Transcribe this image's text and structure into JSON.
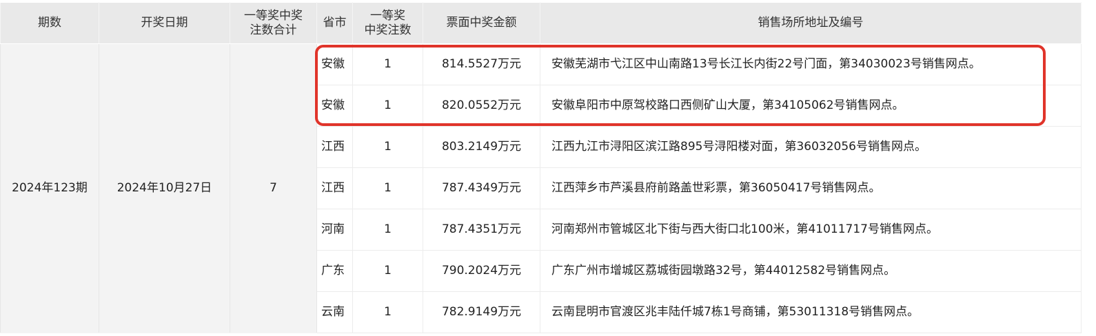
{
  "columns": {
    "period": "期数",
    "date": "开奖日期",
    "total_line1": "一等奖中奖",
    "total_line2": "注数合计",
    "province": "省市",
    "count_line1": "一等奖",
    "count_line2": "中奖注数",
    "amount": "票面中奖金额",
    "address": "销售场所地址及编号"
  },
  "draw": {
    "period": "2024年123期",
    "date": "2024年10月27日",
    "total": "7"
  },
  "rows": [
    {
      "province": "安徽",
      "count": "1",
      "amount": "814.5527万元",
      "address": "安徽芜湖市弋江区中山南路13号长江长内街22号门面，第34030023号销售网点。"
    },
    {
      "province": "安徽",
      "count": "1",
      "amount": "820.0552万元",
      "address": "安徽阜阳市中原驾校路口西侧矿山大厦，第34105062号销售网点。"
    },
    {
      "province": "江西",
      "count": "1",
      "amount": "803.2149万元",
      "address": "江西九江市浔阳区滨江路895号浔阳楼对面，第36032056号销售网点。"
    },
    {
      "province": "江西",
      "count": "1",
      "amount": "787.4349万元",
      "address": "江西萍乡市芦溪县府前路盖世彩票，第36050417号销售网点。"
    },
    {
      "province": "河南",
      "count": "1",
      "amount": "787.4351万元",
      "address": "河南郑州市管城区北下街与西大街口北100米，第41011717号销售网点。"
    },
    {
      "province": "广东",
      "count": "1",
      "amount": "790.2024万元",
      "address": "广东广州市增城区荔城街园墩路32号，第44012582号销售网点。"
    },
    {
      "province": "云南",
      "count": "1",
      "amount": "782.9149万元",
      "address": "云南昆明市官渡区兆丰陆仟城7栋1号商铺，第53011318号销售网点。"
    }
  ],
  "highlight_color": "#e0342a"
}
